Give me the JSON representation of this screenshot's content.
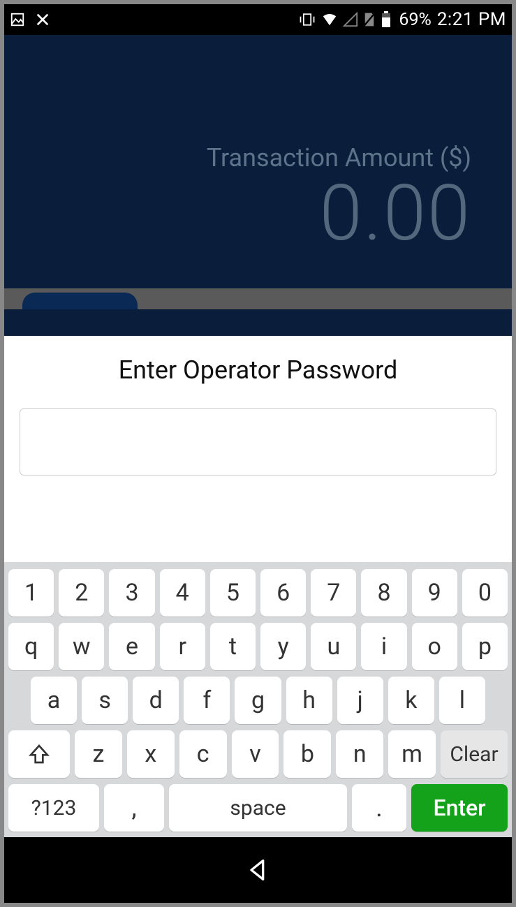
{
  "status": {
    "icons_left": [
      "image-icon",
      "cross-icon"
    ],
    "icons_right": [
      "vibrate-icon",
      "wifi-icon",
      "cell-empty-icon",
      "sim-off-icon",
      "battery-icon"
    ],
    "battery_pct": "69%",
    "time": "2:21 PM"
  },
  "app": {
    "amount_label": "Transaction Amount ($)",
    "amount_value": "0.00"
  },
  "dialog": {
    "title": "Enter Operator Password",
    "input_value": ""
  },
  "keyboard": {
    "row1": [
      "1",
      "2",
      "3",
      "4",
      "5",
      "6",
      "7",
      "8",
      "9",
      "0"
    ],
    "row2": [
      "q",
      "w",
      "e",
      "r",
      "t",
      "y",
      "u",
      "i",
      "o",
      "p"
    ],
    "row3": [
      "a",
      "s",
      "d",
      "f",
      "g",
      "h",
      "j",
      "k",
      "l"
    ],
    "row4": [
      "z",
      "x",
      "c",
      "v",
      "b",
      "n",
      "m"
    ],
    "clear": "Clear",
    "mode": "?123",
    "comma": ",",
    "space": "space",
    "period": ".",
    "enter": "Enter"
  }
}
